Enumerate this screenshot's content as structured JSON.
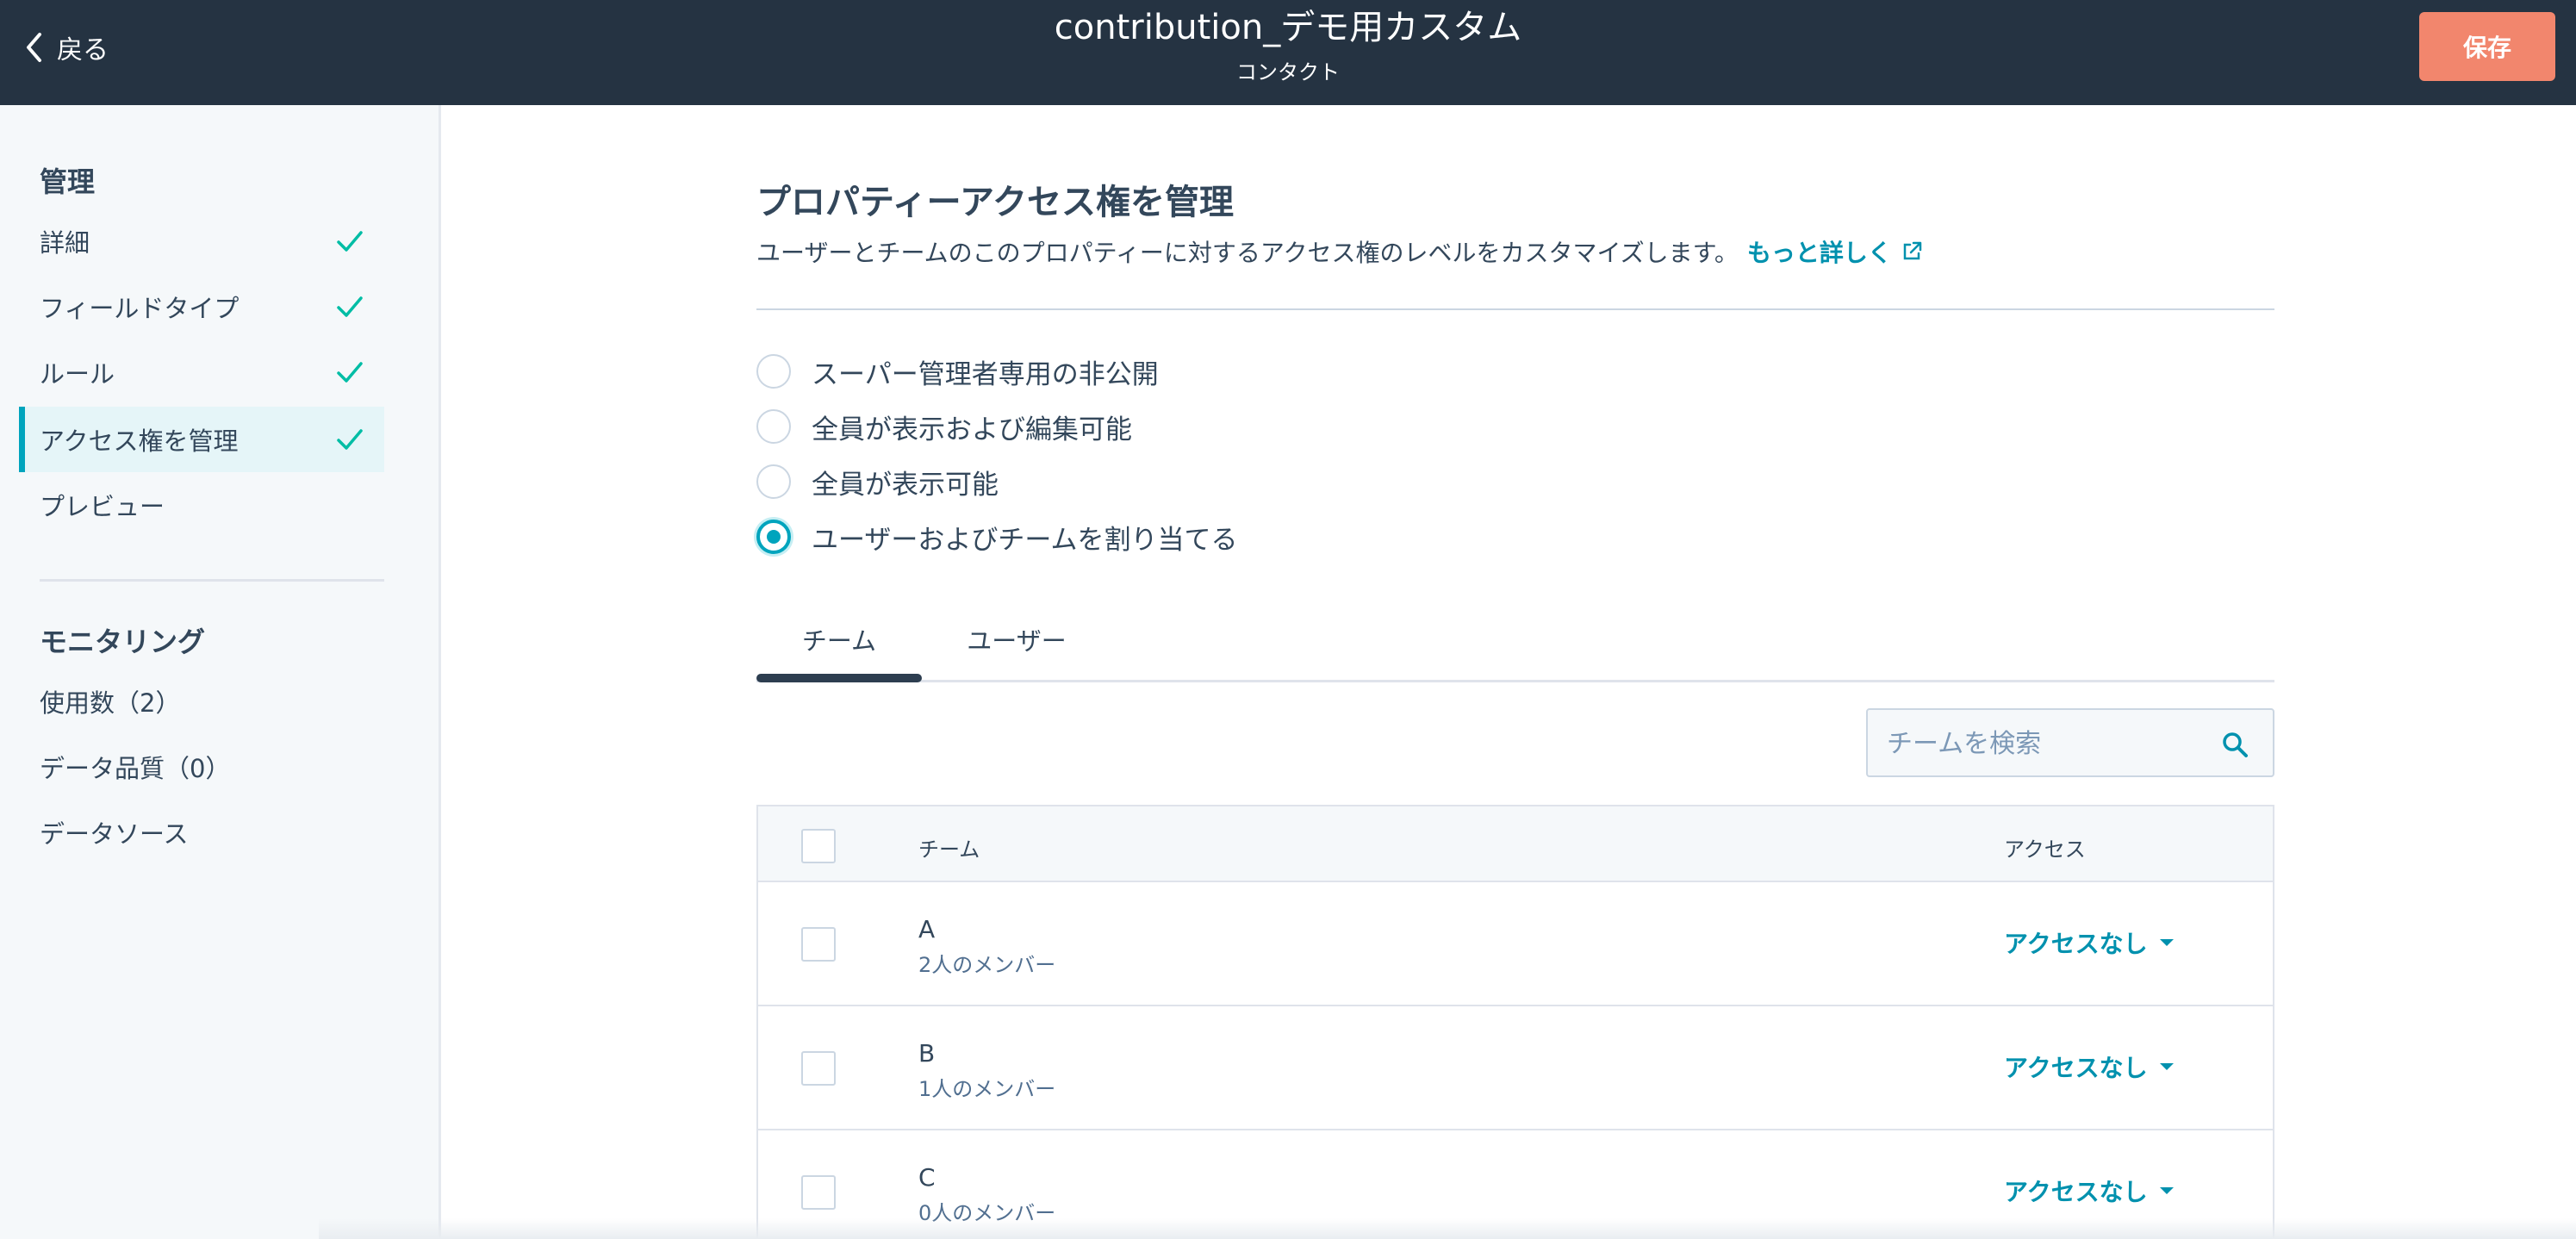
{
  "header": {
    "back_label": "戻る",
    "title": "contribution_デモ用カスタム",
    "subtitle": "コンタクト",
    "save_label": "保存"
  },
  "sidebar": {
    "manage_heading": "管理",
    "items": [
      {
        "label": "詳細",
        "done": true
      },
      {
        "label": "フィールドタイプ",
        "done": true
      },
      {
        "label": "ルール",
        "done": true
      },
      {
        "label": "アクセス権を管理",
        "done": true,
        "active": true
      },
      {
        "label": "プレビュー",
        "done": false
      }
    ],
    "monitoring_heading": "モニタリング",
    "monitoring_items": [
      {
        "label": "使用数（2）"
      },
      {
        "label": "データ品質（0）"
      },
      {
        "label": "データソース"
      }
    ]
  },
  "main": {
    "title": "プロパティーアクセス権を管理",
    "description": "ユーザーとチームのこのプロパティーに対するアクセス権のレベルをカスタマイズします。",
    "learn_more": "もっと詳しく",
    "options": [
      {
        "label": "スーパー管理者専用の非公開",
        "selected": false
      },
      {
        "label": "全員が表示および編集可能",
        "selected": false
      },
      {
        "label": "全員が表示可能",
        "selected": false
      },
      {
        "label": "ユーザーおよびチームを割り当てる",
        "selected": true
      }
    ],
    "tabs": [
      {
        "label": "チーム",
        "active": true
      },
      {
        "label": "ユーザー",
        "active": false
      }
    ],
    "search_placeholder": "チームを検索",
    "table": {
      "columns": {
        "team": "チーム",
        "access": "アクセス"
      },
      "rows": [
        {
          "name": "A",
          "members": "2人のメンバー",
          "access": "アクセスなし"
        },
        {
          "name": "B",
          "members": "1人のメンバー",
          "access": "アクセスなし"
        },
        {
          "name": "C",
          "members": "0人のメンバー",
          "access": "アクセスなし"
        }
      ]
    }
  },
  "colors": {
    "header_bg": "#253342",
    "save_button": "#f2866d",
    "accent": "#00a4bd",
    "link": "#0091ae",
    "check": "#00bda5"
  }
}
